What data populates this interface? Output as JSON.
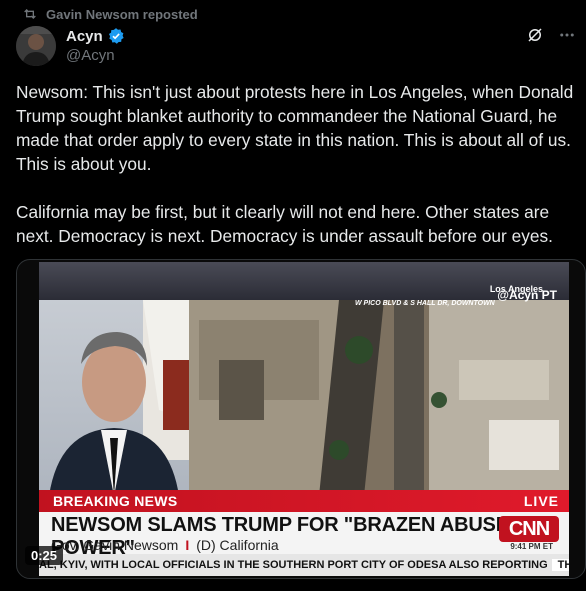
{
  "repost": {
    "text": "Gavin Newsom reposted"
  },
  "author": {
    "display_name": "Acyn",
    "handle": "@Acyn"
  },
  "tweet": {
    "text": "Newsom: This isn't just about protests here in Los Angeles, when Donald Trump sought blanket authority to commandeer the National Guard, he made that order apply to every state in this nation. This is about all of us. This is about you.\n\nCalifornia may be first, but it clearly will not end here. Other states are next. Democracy is next. Democracy is under assault before our eyes."
  },
  "video": {
    "breaking": "BREAKING NEWS",
    "live": "LIVE",
    "headline": "NEWSOM SLAMS TRUMP FOR \"BRAZEN ABUSE OF POWER\"",
    "subtitle_name": "Gov. Gavin Newsom",
    "subtitle_sep": "I",
    "subtitle_party": "(D) California",
    "network": "CNN",
    "clock": "9:41 PM ET",
    "crawl": "AL, KYIV, WITH LOCAL OFFICIALS IN THE SOUTHERN PORT CITY OF ODESA ALSO REPORTING",
    "crawl_source": "THE SOURCE",
    "location": "Los Angeles",
    "location_time": "PT",
    "watermark": "@Acyn",
    "street": "W PICO BLVD & S HALL DR, DOWNTOWN",
    "timestamp": "0:25"
  },
  "colors": {
    "accent": "#1d9bf0",
    "breaking_red": "#c1121f"
  }
}
